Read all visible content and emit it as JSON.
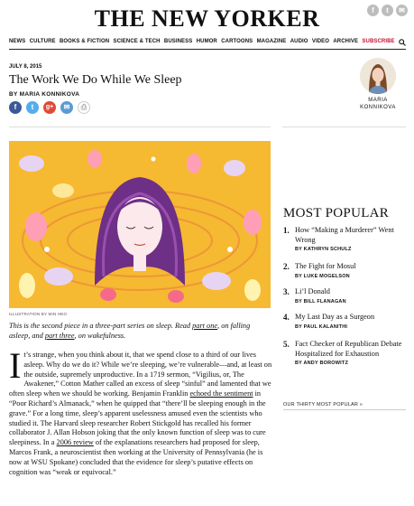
{
  "masthead": "THE NEW YORKER",
  "social_top": [
    {
      "icon": "facebook-icon",
      "glyph": "f"
    },
    {
      "icon": "twitter-icon",
      "glyph": "t"
    },
    {
      "icon": "email-icon",
      "glyph": "✉"
    }
  ],
  "nav": [
    "NEWS",
    "CULTURE",
    "BOOKS & FICTION",
    "SCIENCE & TECH",
    "BUSINESS",
    "HUMOR",
    "CARTOONS",
    "MAGAZINE",
    "AUDIO",
    "VIDEO",
    "ARCHIVE",
    "SUBSCRIBE"
  ],
  "nav_search_icon": "search-icon",
  "article": {
    "date": "JULY 8, 2015",
    "title": "The Work We Do While We Sleep",
    "byline": "BY MARIA KONNIKOVA",
    "share": [
      {
        "icon": "facebook-icon",
        "glyph": "f",
        "color": "#3b5998"
      },
      {
        "icon": "twitter-icon",
        "glyph": "t",
        "color": "#55acee"
      },
      {
        "icon": "google-plus-icon",
        "glyph": "g+",
        "color": "#dd4b39"
      },
      {
        "icon": "email-icon",
        "glyph": "✉",
        "color": "#5a9bd4"
      },
      {
        "icon": "print-icon",
        "glyph": "⎙",
        "color": "#cccccc"
      }
    ],
    "author_card": {
      "first": "MARIA",
      "last": "KONNIKOVA"
    },
    "illustration_credit": "ILLUSTRATION BY MIN HEO",
    "intro_pre": "This is the second piece in a three-part series on sleep. Read ",
    "intro_link1": "part one",
    "intro_mid": ", on falling asleep, and ",
    "intro_link2": "part three",
    "intro_post": ", on wakefulness.",
    "drop_cap": "I",
    "body_1": "t’s strange, when you think about it, that we spend close to a third of our lives asleep. Why do we do it? While we’re sleeping, we’re vulnerable—and, at least on the outside, supremely unproductive. In a 1719 sermon, “Vigilius, or, The Awakener,” Cotton Mather called an excess of sleep “sinful” and lamented that we often sleep when we should be working. Benjamin Franklin ",
    "body_link1": "echoed the sentiment",
    "body_2": " in “Poor Richard’s Almanack,” when he quipped that “there’ll be sleeping enough in the grave.” For a long time, sleep’s apparent uselessness amused even the scientists who studied it. The Harvard sleep researcher Robert Stickgold has recalled his former collaborator J. Allan Hobson joking that the only known function of sleep was to cure sleepiness. In a ",
    "body_link2": "2006 review",
    "body_3": " of the explanations researchers had proposed for sleep, Marcos Frank, a neuroscientist then working at the University of Pennsylvania (he is now at WSU Spokane) concluded that the evidence for sleep’s putative effects on cognition was “weak or equivocal.”"
  },
  "most_popular": {
    "title": "MOST POPULAR",
    "items": [
      {
        "num": "1.",
        "headline": "How “Making a Murderer” Went Wrong",
        "by": "BY KATHRYN SCHULZ"
      },
      {
        "num": "2.",
        "headline": "The Fight for Mosul",
        "by": "BY LUKE MOGELSON"
      },
      {
        "num": "3.",
        "headline": "Li’l Donald",
        "by": "BY BILL FLANAGAN"
      },
      {
        "num": "4.",
        "headline": "My Last Day as a Surgeon",
        "by": "BY PAUL KALANITHI"
      },
      {
        "num": "5.",
        "headline": "Fact Checker of Republican Debate Hospitalized for Exhaustion",
        "by": "BY ANDY BOROWITZ"
      }
    ],
    "more_link": "OUR THIRTY MOST POPULAR »"
  }
}
